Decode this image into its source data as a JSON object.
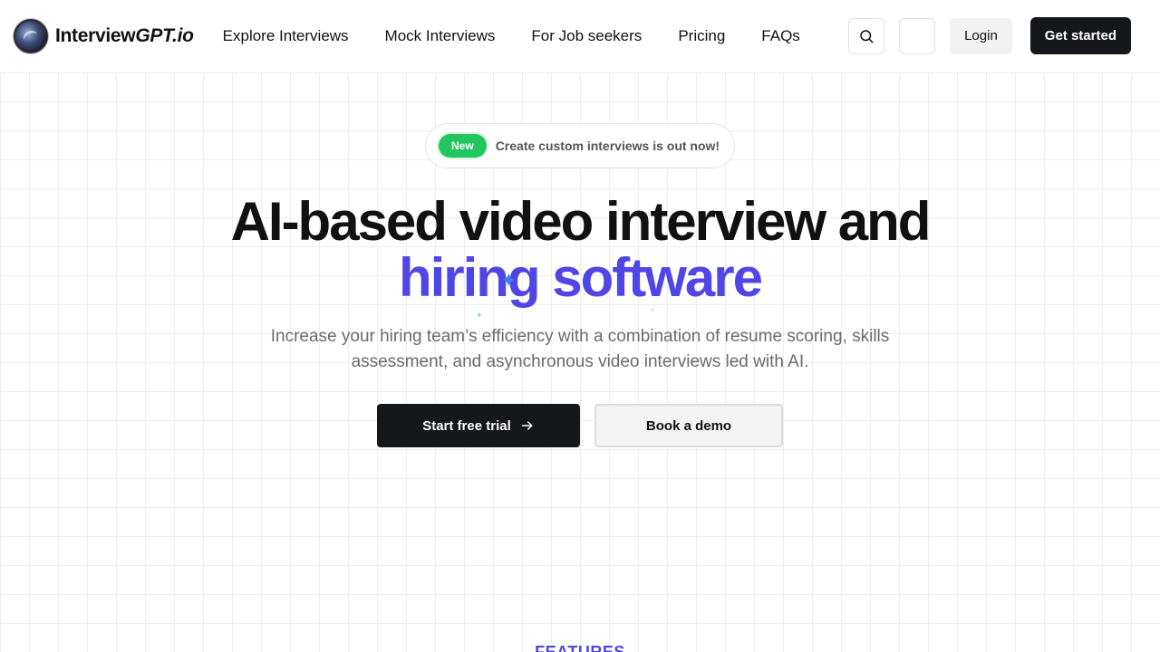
{
  "header": {
    "logo": {
      "name_part1": "Interview",
      "name_part2": "GPT.io",
      "icon": "interviewgpt-logo-icon"
    },
    "nav": [
      {
        "label": "Explore Interviews"
      },
      {
        "label": "Mock Interviews"
      },
      {
        "label": "For Job seekers"
      },
      {
        "label": "Pricing"
      },
      {
        "label": "FAQs"
      }
    ],
    "search_icon": "search-icon",
    "login_label": "Login",
    "cta_label": "Get started"
  },
  "hero": {
    "badge": {
      "label": "New",
      "text": "Create custom interviews is out now!"
    },
    "title_line1": "AI-based video interview and",
    "title_line2": "hiring software",
    "subtitle_line1": "Increase your hiring team’s efficiency with a combination of resume scoring, skills",
    "subtitle_line2": "assessment, and asynchronous video interviews led with AI.",
    "primary_button": "Start free trial",
    "secondary_button": "Book a demo"
  },
  "features": {
    "label": "FEATURES"
  },
  "colors": {
    "accent": "#4f46e5",
    "badge_green": "#22c55e",
    "dark_button": "#16171a"
  }
}
